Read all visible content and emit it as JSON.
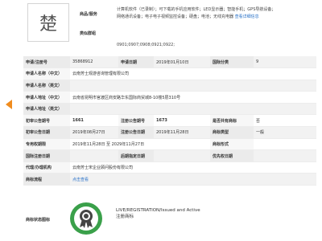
{
  "trademark": {
    "logo_text": "楚",
    "goods_services_label": "商品/服务",
    "goods_services_line1": "计算机软件（已录制）；可下载的手机应用软件；LED显示器；智能手机；GPS导航设备；",
    "goods_services_line2": "网络通讯设备；电子电子视频监控设备；硬盘；电池；无线充电器",
    "goods_services_link": "查看详细信息",
    "similar_groups_label": "类似群组",
    "similar_groups_value": "0901;0907;0908;0921;0922;"
  },
  "fields": {
    "reg_no_label": "申请/注册号",
    "reg_no": "35868912",
    "app_date_label": "申请日期",
    "app_date": "2019年01月10日",
    "intl_class_label": "国际分类",
    "intl_class": "9",
    "applicant_cn_label": "申请人名称（中文）",
    "applicant_cn": "云南芳士观游咨询管理有限公司",
    "applicant_en_label": "申请人名称（英文）",
    "address_cn_label": "申请人地址（中文）",
    "address_cn": "云南省昆明市官渡区商安路华东国际商贸城8-10楼5层310号",
    "address_en_label": "申请人地址（英文）",
    "prelim_no_label": "初审公告期号",
    "prelim_no": "1661",
    "reg_pub_no_label": "注册公告期号",
    "reg_pub_no": "1673",
    "shared_label": "是否共有商标",
    "shared": "否",
    "prelim_date_label": "初审公告日期",
    "prelim_date": "2019年08月27日",
    "reg_pub_date_label": "注册公告日期",
    "reg_pub_date": "2019年11月28日",
    "tm_type_label": "商标类型",
    "tm_type": "一般",
    "exclusive_label": "专用权期限",
    "exclusive": "2019年11月28日 至 2029年11月27日",
    "tm_form_label": "商标形式",
    "intl_reg_date_label": "国际注册日期",
    "later_desig_label": "后期指定日期",
    "priority_date_label": "优先权日期",
    "agent_label": "代理/办理机构",
    "agent": "云南芳士宋企业顾问股份有限公司",
    "process_label": "商标流程",
    "process_link": "点击查看"
  },
  "status": {
    "label": "商标状态图标",
    "line1": "LIVE/REGISTRATION/Issued and Active",
    "line2": "注册商标",
    "color": "#3aa04a"
  },
  "icons": {
    "nav": "chevron-left-icon",
    "badge": "ribbon-award-icon"
  }
}
